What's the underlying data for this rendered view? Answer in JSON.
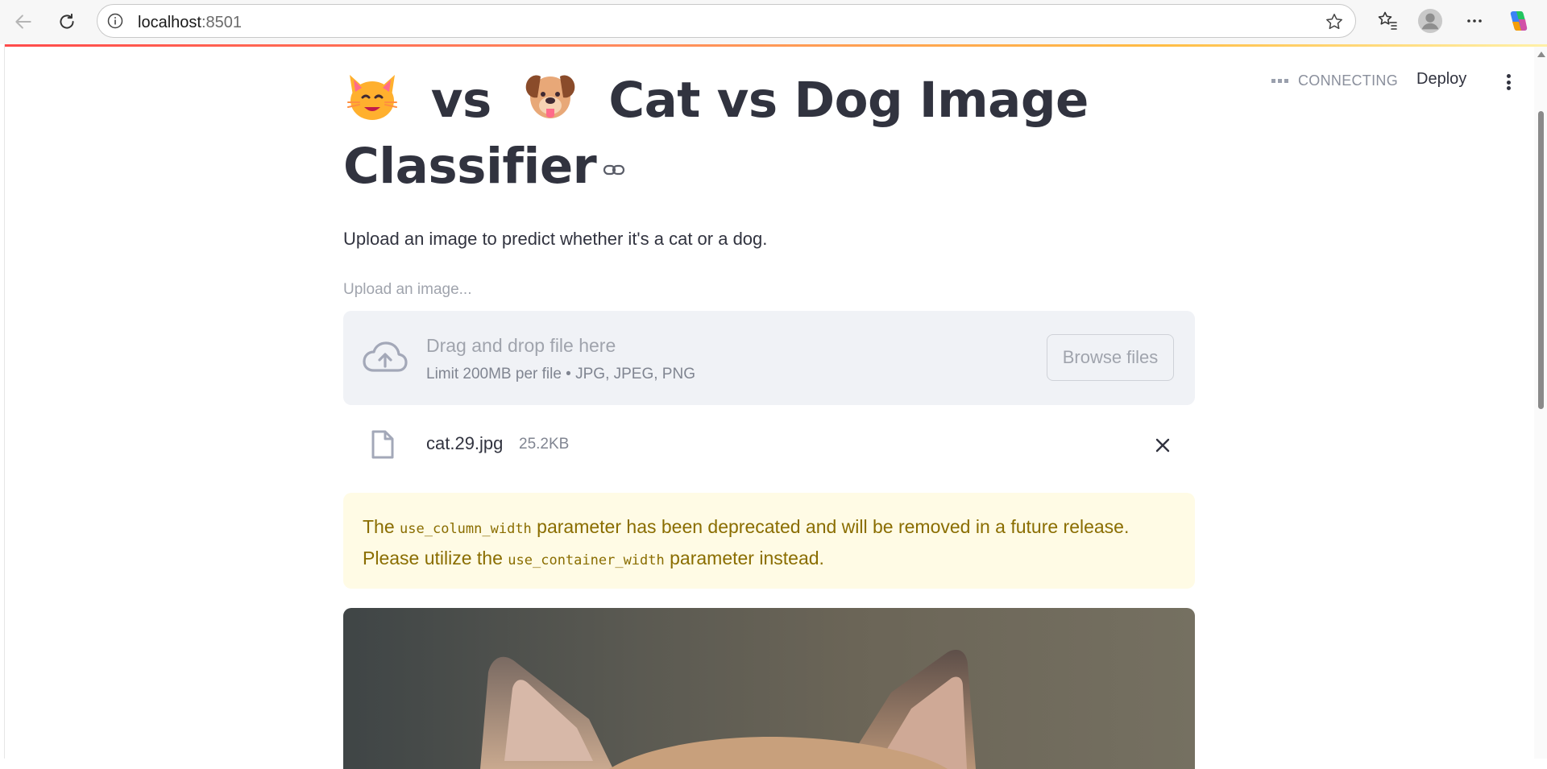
{
  "browser": {
    "url_host": "localhost",
    "url_port": ":8501"
  },
  "streamlit": {
    "status": "CONNECTING",
    "deploy_label": "Deploy"
  },
  "app": {
    "title_vs": "vs",
    "title_text": "Cat vs Dog Image",
    "title_line2": "Classifier",
    "subtitle": "Upload an image to predict whether it's a cat or a dog.",
    "uploader": {
      "label": "Upload an image...",
      "drop_title": "Drag and drop file here",
      "drop_limit": "Limit 200MB per file • JPG, JPEG, PNG",
      "browse_label": "Browse files"
    },
    "file": {
      "name": "cat.29.jpg",
      "size": "25.2KB"
    },
    "warning": {
      "part1": "The ",
      "code1": "use_column_width",
      "part2": " parameter has been deprecated and will be removed in a future release. Please utilize the ",
      "code2": "use_container_width",
      "part3": " parameter instead."
    }
  },
  "colors": {
    "accent": "#ff4b4b",
    "text": "#31333f",
    "warning_bg": "#fffbe5",
    "warning_text": "#8a6d00",
    "dropzone_bg": "#f0f2f6"
  },
  "icons": [
    "back-arrow-icon",
    "reload-icon",
    "info-icon",
    "star-icon",
    "favorites-icon",
    "profile-icon",
    "more-icon",
    "copilot-icon",
    "cat-emoji-icon",
    "dog-emoji-icon",
    "link-icon",
    "cloud-upload-icon",
    "file-icon",
    "close-icon",
    "kebab-menu-icon"
  ]
}
